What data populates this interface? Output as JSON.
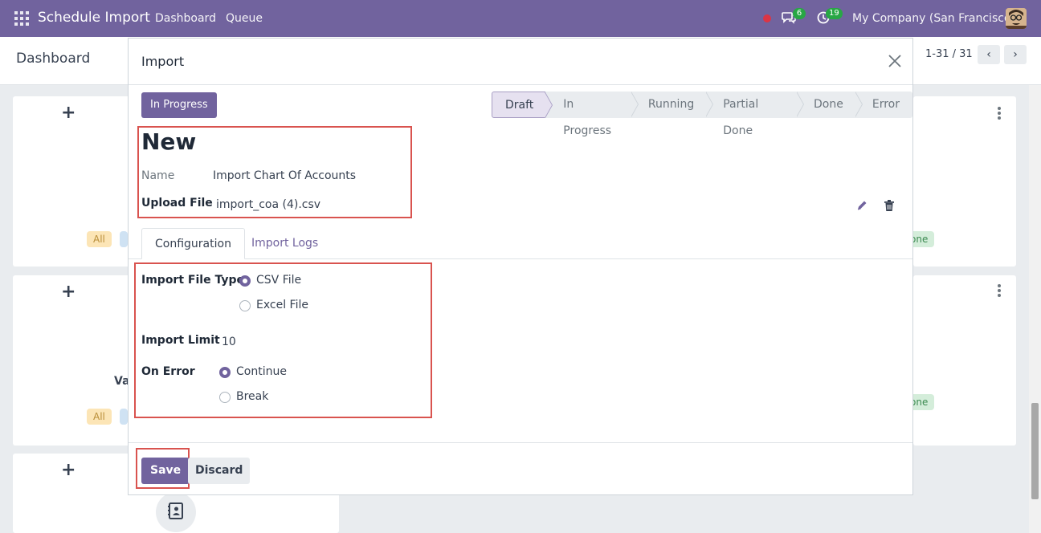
{
  "topbar": {
    "app_title": "Schedule Import",
    "nav": [
      "Dashboard",
      "Queue"
    ],
    "chat_count": "6",
    "activity_count": "19",
    "company": "My Company (San Francisco)"
  },
  "control_panel": {
    "breadcrumb": "Dashboard",
    "pager": "1-31 / 31",
    "prev": "‹",
    "next": "›"
  },
  "background": {
    "filter_all": "All",
    "filter_done": "one",
    "partial_text": "Va"
  },
  "modal": {
    "title": "Import",
    "status_button": "In Progress",
    "stages": [
      "Draft",
      "In Progress",
      "Running",
      "Partial Done",
      "Done",
      "Error"
    ],
    "active_stage": "Draft",
    "record_title": "New",
    "name_label": "Name",
    "name_value": "Import Chart Of Accounts",
    "upload_label": "Upload File",
    "upload_value": "import_coa (4).csv",
    "tabs": [
      "Configuration",
      "Import Logs"
    ],
    "config": {
      "file_type_label": "Import File Type",
      "file_type_options": [
        "CSV File",
        "Excel File"
      ],
      "file_type_selected": "CSV File",
      "limit_label": "Import Limit",
      "limit_value": "10",
      "on_error_label": "On Error",
      "on_error_options": [
        "Continue",
        "Break"
      ],
      "on_error_selected": "Continue"
    },
    "save_label": "Save",
    "discard_label": "Discard"
  },
  "colors": {
    "brand": "#71639e",
    "highlight": "#d9534f"
  }
}
